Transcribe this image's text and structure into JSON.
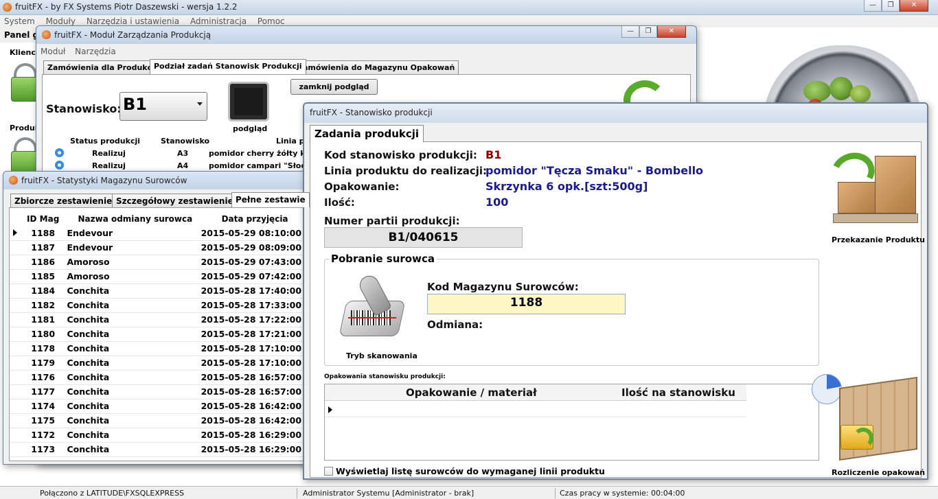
{
  "main": {
    "title": "fruitFX - by FX Systems Piotr Daszewski - wersja 1.2.2",
    "menu": [
      "System",
      "Moduły",
      "Narzędzia i ustawienia",
      "Administracja",
      "Pomoc"
    ],
    "tab": "Panel gł",
    "side": {
      "clients": "Klienci",
      "produce": "Produk"
    },
    "status": {
      "connection": "Połączono z LATITUDE\\FXSQLEXPRESS",
      "user": "Administrator Systemu [Administrator - brak]",
      "time": "Czas pracy w systemie: 00:04:00"
    }
  },
  "modul": {
    "title": "fruitFX - Moduł Zarządzania Produkcją",
    "menu": [
      "Moduł",
      "Narzędzia"
    ],
    "tabs": [
      "Zamówienia dla Produkcji",
      "Podział zadań Stanowisk Produkcji",
      "Zamówienia do Magazynu Opakowań"
    ],
    "station_label": "Stanowisko:",
    "station_value": "B1",
    "preview_label": "podgląd",
    "close_preview": "zamknij podgląd",
    "grid_headers": [
      "Status produkcji",
      "Stanowisko",
      "Linia p"
    ],
    "rows": [
      {
        "status": "Realizuj",
        "station": "A3",
        "line": "pomidor cherry żółty kl I"
      },
      {
        "status": "Realizuj",
        "station": "A4",
        "line": "pomidor campari \"Słodki"
      }
    ]
  },
  "stat": {
    "title": "fruitFX - Statystyki Magazynu Surowców",
    "tabs": [
      "Zbiorcze zestawienie",
      "Szczegółowy zestawienie",
      "Pełne zestawie"
    ],
    "headers": [
      "ID Mag",
      "Nazwa odmiany surowca",
      "Data przyjęcia"
    ],
    "rows": [
      {
        "id": "1188",
        "name": "Endevour",
        "date": "2015-05-29 08:10:00"
      },
      {
        "id": "1187",
        "name": "Endevour",
        "date": "2015-05-29 08:09:00"
      },
      {
        "id": "1186",
        "name": "Amoroso",
        "date": "2015-05-29 07:43:00"
      },
      {
        "id": "1185",
        "name": "Amoroso",
        "date": "2015-05-29 07:42:00"
      },
      {
        "id": "1184",
        "name": "Conchita",
        "date": "2015-05-28 17:40:00"
      },
      {
        "id": "1182",
        "name": "Conchita",
        "date": "2015-05-28 17:33:00"
      },
      {
        "id": "1181",
        "name": "Conchita",
        "date": "2015-05-28 17:22:00"
      },
      {
        "id": "1180",
        "name": "Conchita",
        "date": "2015-05-28 17:21:00"
      },
      {
        "id": "1178",
        "name": "Conchita",
        "date": "2015-05-28 17:10:00"
      },
      {
        "id": "1179",
        "name": "Conchita",
        "date": "2015-05-28 17:10:00"
      },
      {
        "id": "1176",
        "name": "Conchita",
        "date": "2015-05-28 16:57:00"
      },
      {
        "id": "1177",
        "name": "Conchita",
        "date": "2015-05-28 16:57:00"
      },
      {
        "id": "1174",
        "name": "Conchita",
        "date": "2015-05-28 16:42:00"
      },
      {
        "id": "1175",
        "name": "Conchita",
        "date": "2015-05-28 16:42:00"
      },
      {
        "id": "1172",
        "name": "Conchita",
        "date": "2015-05-28 16:29:00"
      },
      {
        "id": "1173",
        "name": "Conchita",
        "date": "2015-05-28 16:29:00"
      }
    ]
  },
  "stan": {
    "title": "fruitFX - Stanowisko produkcji",
    "tab": "Zadania produkcji",
    "fields": {
      "station_code_label": "Kod stanowisko produkcji:",
      "station_code": "B1",
      "line_label": "Linia produktu do realizacji:",
      "line": "pomidor \"Tęcza Smaku\" - Bombello",
      "package_label": "Opakowanie:",
      "package": "Skrzynka 6 opk.[szt:500g]",
      "qty_label": "Ilość:",
      "qty": "100",
      "batch_label": "Numer partii produkcji:",
      "batch": "B1/040615"
    },
    "raw": {
      "group_label": "Pobranie surowca",
      "scan_mode": "Tryb skanowania",
      "code_label": "Kod Magazynu Surowców:",
      "code": "1188",
      "variety_label": "Odmiana:"
    },
    "packages": {
      "caption": "Opakowania stanowisku produkcji:",
      "headers": [
        "Opakowanie / materiał",
        "Ilość na stanowisku"
      ]
    },
    "checkbox_label": "Wyświetlaj listę surowców do wymaganej linii produktu",
    "transfer_label": "Przekazanie Produktu",
    "settle_label": "Rozliczenie opakowań"
  }
}
